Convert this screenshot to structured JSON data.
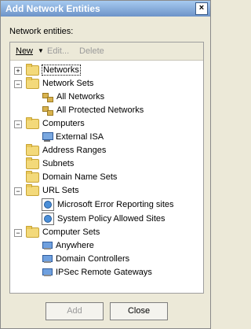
{
  "window": {
    "title": "Add Network Entities",
    "close_glyph": "×"
  },
  "label": "Network entities:",
  "toolbar": {
    "new": "New",
    "new_arrow": "▼",
    "edit": "Edit...",
    "delete": "Delete"
  },
  "tree": {
    "networks": "Networks",
    "network_sets": "Network Sets",
    "all_networks": "All Networks",
    "all_protected_networks": "All Protected Networks",
    "computers": "Computers",
    "external_isa": "External ISA",
    "address_ranges": "Address Ranges",
    "subnets": "Subnets",
    "domain_name_sets": "Domain Name Sets",
    "url_sets": "URL Sets",
    "ms_error_reporting": "Microsoft Error Reporting sites",
    "system_policy_allowed": "System Policy Allowed Sites",
    "computer_sets": "Computer Sets",
    "anywhere": "Anywhere",
    "domain_controllers": "Domain Controllers",
    "ipsec_remote_gateways": "IPSec Remote Gateways"
  },
  "buttons": {
    "add": "Add",
    "close": "Close"
  }
}
